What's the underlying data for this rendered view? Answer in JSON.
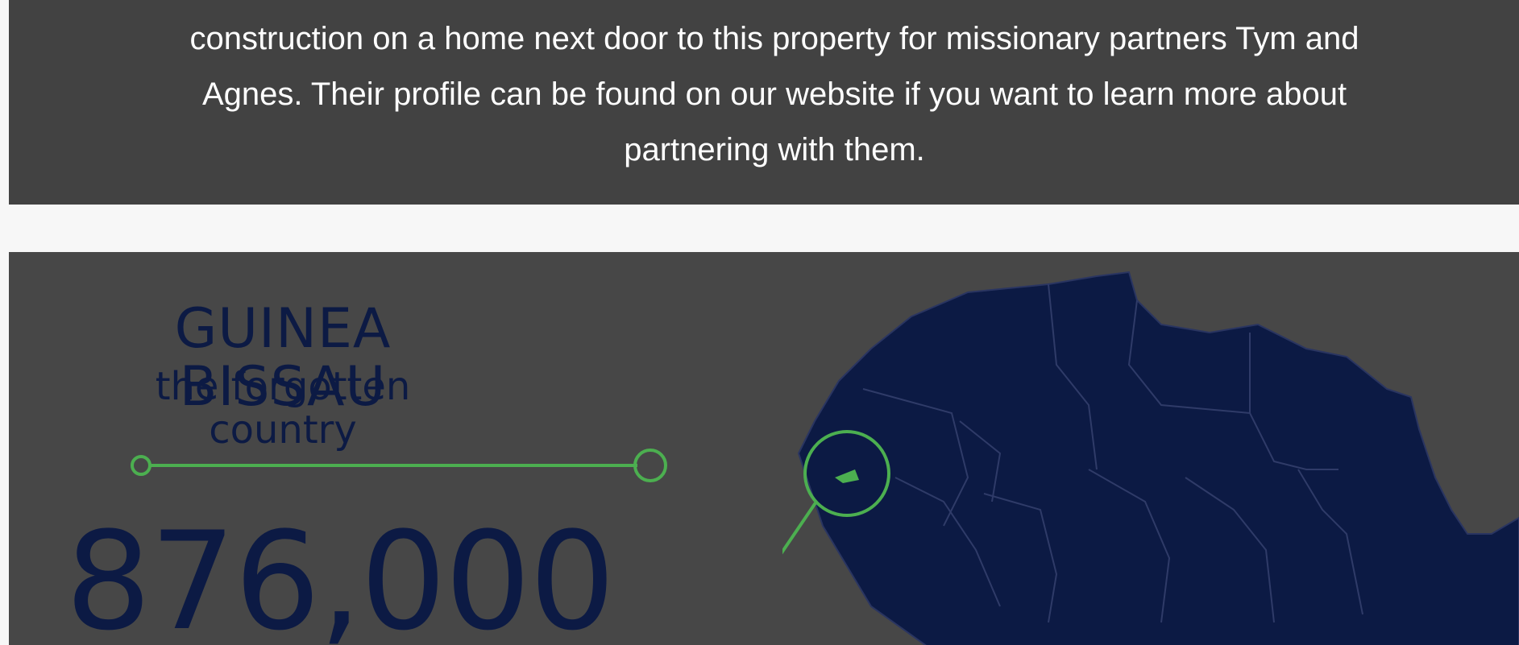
{
  "story": {
    "lines": [
      "construction on a home next door to this property for missionary partners Tym and",
      "Agnes.  Their profile can be found on our website if you want to learn more about",
      "partnering with them."
    ]
  },
  "infographic": {
    "title": "GUINEA BISSAU",
    "subtitle": "the forgotten country",
    "number": "876,000",
    "colors": {
      "panel": "#474747",
      "navy": "#0c1a44",
      "accent_green": "#4caf50"
    },
    "icons": [
      "divider-line-icon",
      "africa-map-icon",
      "highlight-circle-icon"
    ]
  }
}
